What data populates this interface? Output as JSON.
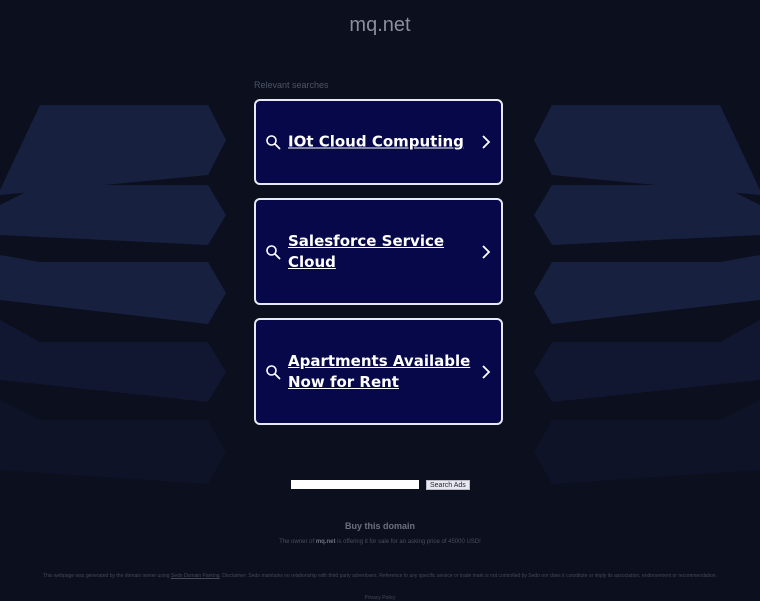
{
  "header": {
    "domain": "mq.net"
  },
  "relevant_searches": {
    "label": "Relevant searches",
    "items": [
      {
        "label": "IOt Cloud Computing"
      },
      {
        "label": "Salesforce Service Cloud"
      },
      {
        "label": "Apartments Available Now for Rent"
      }
    ]
  },
  "search": {
    "placeholder": "",
    "button_label": "Search Ads"
  },
  "sale": {
    "buy_label": "Buy this domain",
    "owner_prefix": "The owner of ",
    "owner_domain": "mq.net",
    "owner_suffix": " is offering it for sale for an asking price of 45000 USD!"
  },
  "footer": {
    "disclaimer_prefix": "This webpage was generated by the domain owner using ",
    "disclaimer_link": "Sedo Domain Parking",
    "disclaimer_suffix": ". Disclaimer: Sedo maintains no relationship with third party advertisers. Reference to any specific service or trade mark is not controlled by Sedo nor does it constitute or imply its association, endorsement or recommendation.",
    "privacy": "Privacy Policy"
  },
  "colors": {
    "background": "#0b0f1e",
    "card_background": "#06084a",
    "card_border": "#e8eaf2",
    "shape_fill": "#18203f"
  },
  "icons": {
    "card_left": "search-icon",
    "card_right": "chevron-right-icon"
  }
}
